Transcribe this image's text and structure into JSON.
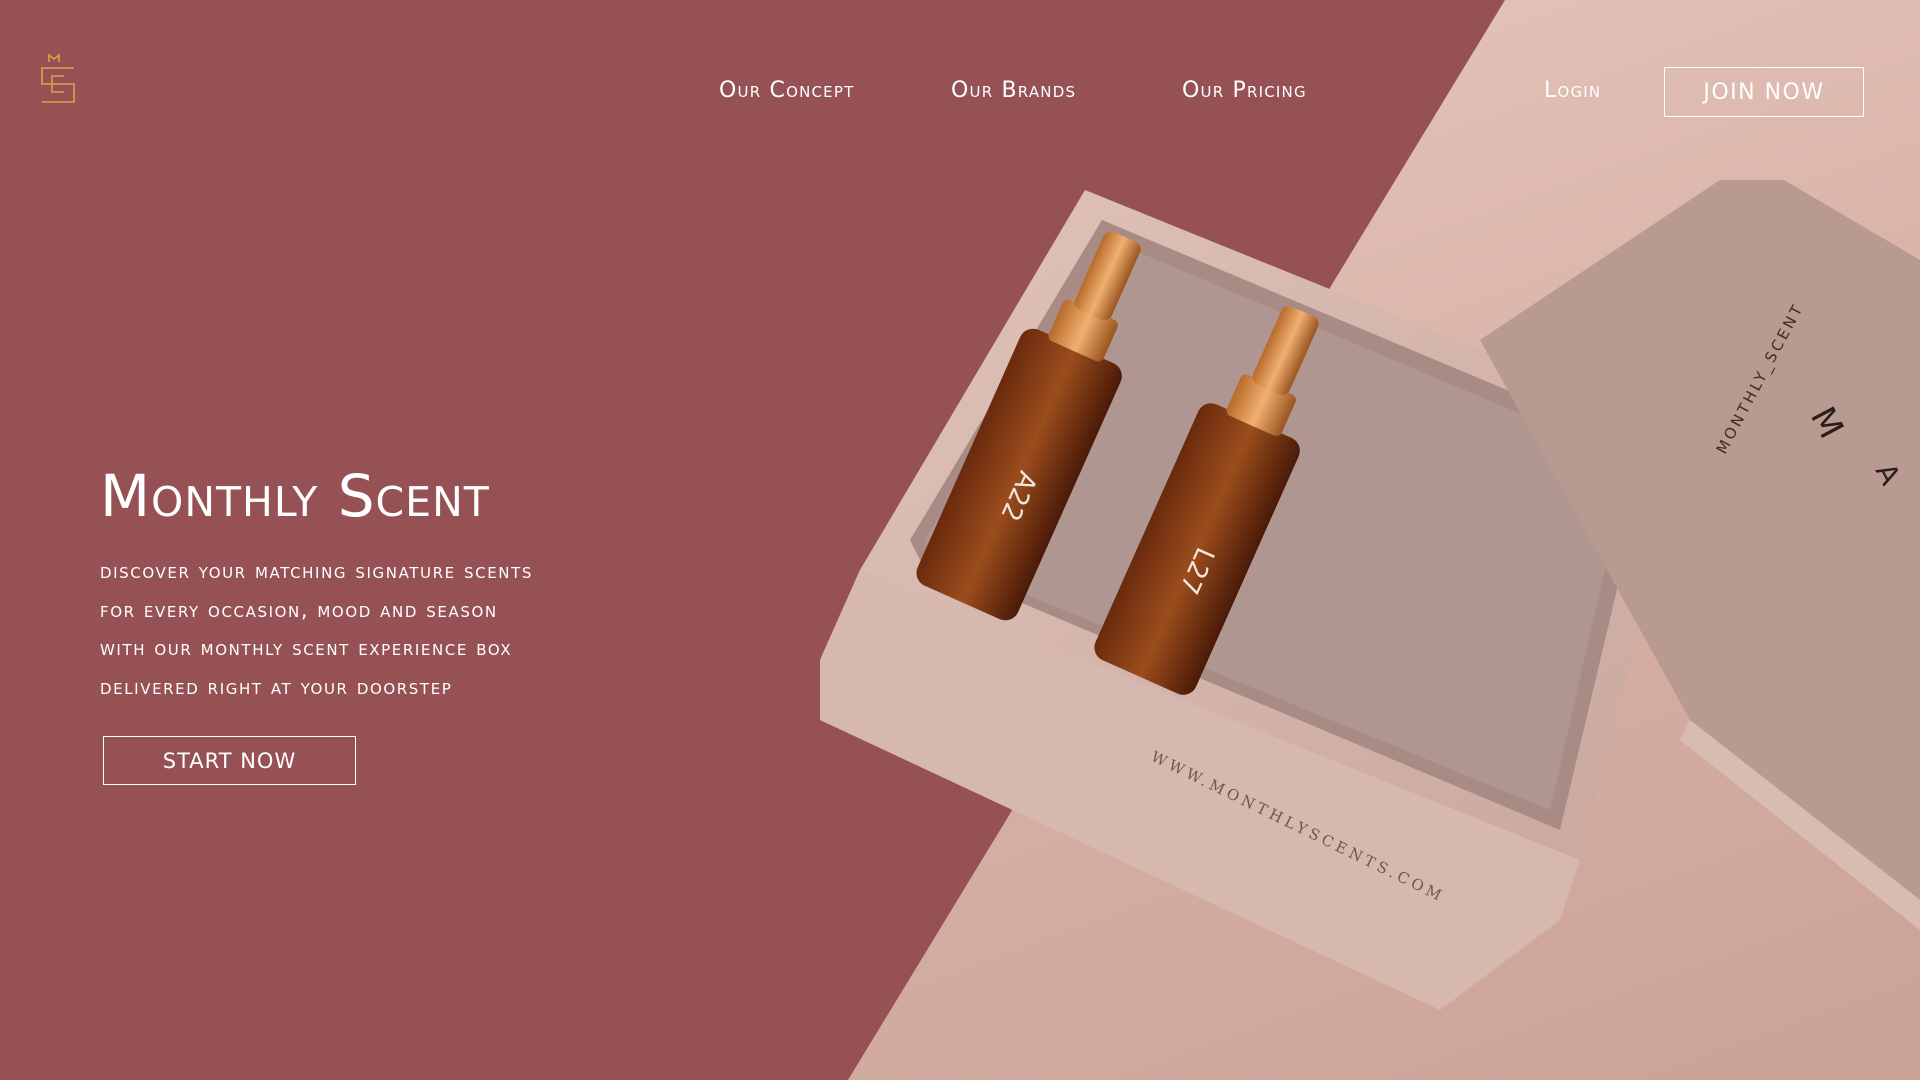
{
  "brand": {
    "logo_letters": "MS"
  },
  "nav": {
    "links": [
      "Our Concept",
      "Our Brands",
      "Our Pricing"
    ],
    "login_label": "Login",
    "join_label": "JOIN NOW"
  },
  "hero": {
    "title": "Monthly Scent",
    "lines": [
      "discover your matching signature scents",
      "for every occasion, mood and season",
      "with our monthly scent experience box",
      "delivered right at your doorstep"
    ],
    "cta_label": "START NOW"
  },
  "product": {
    "box_website": "WWW.MONTHLYSCENTS.COM",
    "lid_text": "MONTHLY_SCENT",
    "lid_letters": [
      "M",
      "A"
    ],
    "bottle_labels": [
      "A22",
      "L27"
    ]
  },
  "colors": {
    "primary": "#965155",
    "accent_gold": "#d9a34a",
    "background_light": "#dcb9ae"
  },
  "icons": {
    "logo": "ms-monogram-icon"
  }
}
